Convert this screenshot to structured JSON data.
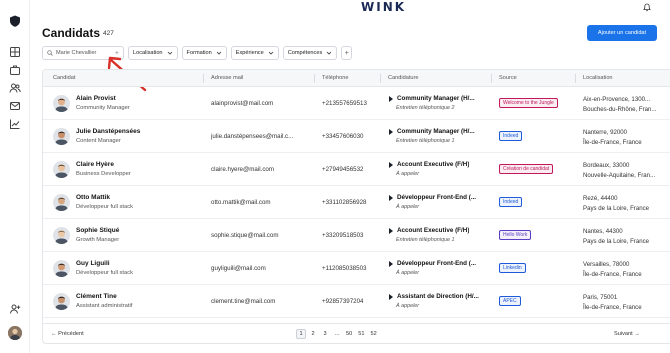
{
  "brand": "WINK",
  "page": {
    "title": "Candidats",
    "count": "427"
  },
  "add_button": "Ajouter un candidat",
  "search": {
    "value": "Marie Chevallier"
  },
  "filters": [
    "Localisation",
    "Formation",
    "Expérience",
    "Compétences"
  ],
  "columns": [
    "Candidat",
    "Adresse mail",
    "Téléphone",
    "Candidature",
    "Source",
    "Localisation"
  ],
  "rows": [
    {
      "name": "Alain Provist",
      "title": "Community Manager",
      "email": "alainprovist@mail.com",
      "phone": "+213557659513",
      "job": "Community Manager (H/...",
      "step": "Entretien téléphonique 2",
      "source": "Welcome to the Jungle",
      "loc1": "Aix-en-Provence, 1300...",
      "loc2": "Bouches-du-Rhône, Fran..."
    },
    {
      "name": "Julie Danstépensées",
      "title": "Content Manager",
      "email": "julie.danstépensees@mail.c...",
      "phone": "+33457606030",
      "job": "Community Manager (H/...",
      "step": "Entretien téléphonique 1",
      "source": "Indeed",
      "loc1": "Nanterre, 92000",
      "loc2": "Île-de-France, France"
    },
    {
      "name": "Claire Hyère",
      "title": "Business Developper",
      "email": "claire.hyere@mail.com",
      "phone": "+27949456532",
      "job": "Account Executive (F/H)",
      "step": "À appeler",
      "source": "Création de candidat",
      "loc1": "Bordeaux, 33000",
      "loc2": "Nouvelle-Aquitaine, Fran..."
    },
    {
      "name": "Otto Mattik",
      "title": "Développeur full stack",
      "email": "otto.mattik@mail.com",
      "phone": "+331102856928",
      "job": "Développeur Front-End (...",
      "step": "À appeler",
      "source": "Indeed",
      "loc1": "Rezé, 44400",
      "loc2": "Pays de la Loire, France"
    },
    {
      "name": "Sophie Stiqué",
      "title": "Growth Manager",
      "email": "sophie.stique@mail.com",
      "phone": "+33209518503",
      "job": "Account Executive (F/H)",
      "step": "Entretien téléphonique 1",
      "source": "Hello Work",
      "loc1": "Nantes, 44300",
      "loc2": "Pays de la Loire, France"
    },
    {
      "name": "Guy Liguili",
      "title": "Développeur full stack",
      "email": "guyliguili@mail.com",
      "phone": "+112085038503",
      "job": "Développeur Front-End (...",
      "step": "À appeler",
      "source": "Linkedin",
      "loc1": "Versailles, 78000",
      "loc2": "Île-de-France, France"
    },
    {
      "name": "Clément Tine",
      "title": "Assistant administratif",
      "email": "clement.tine@mail.com",
      "phone": "+92857397204",
      "job": "Assistant de Direction (H/...",
      "step": "À appeler",
      "source": "APEC",
      "loc1": "Paris, 75001",
      "loc2": "Île-de-France, France"
    }
  ],
  "badge_colors": {
    "Welcome to the Jungle": "#c2185b",
    "Indeed": "#1e5bd8",
    "Création de candidat": "#c2185b",
    "Hello Work": "#5b3cc4",
    "Linkedin": "#1e5bd8",
    "APEC": "#1e5bd8"
  },
  "pagination": {
    "prev": "Précédent",
    "next": "Suivant",
    "pages": [
      "1",
      "2",
      "3",
      "...",
      "50",
      "51",
      "52"
    ]
  },
  "colors": {
    "accent": "#1a73e8",
    "brand": "#1b2a55",
    "annotation": "#d9302a"
  }
}
